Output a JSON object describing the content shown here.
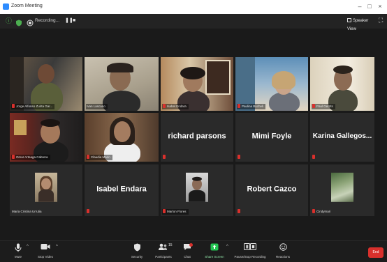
{
  "window": {
    "title": "Zoom Meeting",
    "minimize": "–",
    "maximize": "□",
    "close": "×"
  },
  "topbar": {
    "recording_text": "Recording...",
    "pause": "❚❚",
    "stop": "■",
    "view_label": "Speaker View",
    "fullscreen": "⛶"
  },
  "colors": {
    "accent_green": "#a7d94a",
    "mute_red": "#d9302c",
    "end_red": "#d9302c"
  },
  "tiles": [
    {
      "label": "Jorge Alfonso Zurita Gar...",
      "type": "video"
    },
    {
      "label": "Ivan Lascano",
      "type": "video",
      "active": true
    },
    {
      "label": "Isabel Endara",
      "type": "video"
    },
    {
      "label": "Paulina Bucheli",
      "type": "video"
    },
    {
      "label": "Paul Gerrits",
      "type": "video"
    },
    {
      "label": "Omar Arteaga Cabrera",
      "type": "video"
    },
    {
      "label": "Claudia Marin",
      "type": "video"
    },
    {
      "name": "richard parsons",
      "type": "name"
    },
    {
      "name": "Mimi Foyle",
      "type": "name"
    },
    {
      "name": "Karina Gallegos...",
      "type": "name"
    },
    {
      "label": "Maria Cristina Urrutia",
      "type": "photo"
    },
    {
      "name": "Isabel Endara",
      "type": "name"
    },
    {
      "label": "Marlon Flores",
      "type": "photo"
    },
    {
      "name": "Robert Cazco",
      "type": "name"
    },
    {
      "label": "Cindymari",
      "type": "photo"
    }
  ],
  "toolbar": {
    "mute": "Mute",
    "stop_video": "Stop Video",
    "security": "Security",
    "participants": "Participants",
    "participants_count": "15",
    "chat": "Chat",
    "share_screen": "Share Screen",
    "recording": "Pause/Stop Recording",
    "reactions": "Reactions",
    "end": "End"
  }
}
